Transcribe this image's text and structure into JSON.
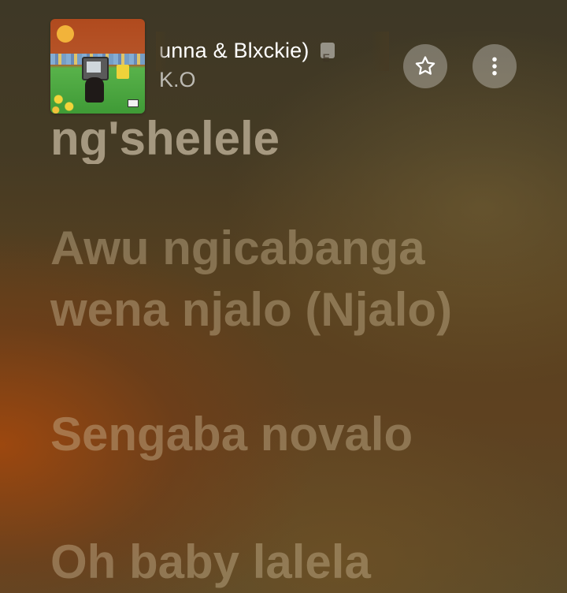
{
  "header": {
    "track_title": "unna & Blxckie)",
    "track_artist": "K.O",
    "explicit_icon": "explicit-badge-icon",
    "star_icon": "star-outline-icon",
    "more_icon": "more-vertical-icon"
  },
  "lyrics": {
    "lines": [
      "ng'shelele",
      "Awu ngicabanga",
      "wena njalo (Njalo)",
      "Sengaba novalo",
      "Oh baby lalela"
    ]
  },
  "colors": {
    "background_top": "#3e3826",
    "background_glow": "#a0480e",
    "lyric_text": "#cdb996",
    "button_bg": "#ffffff"
  }
}
